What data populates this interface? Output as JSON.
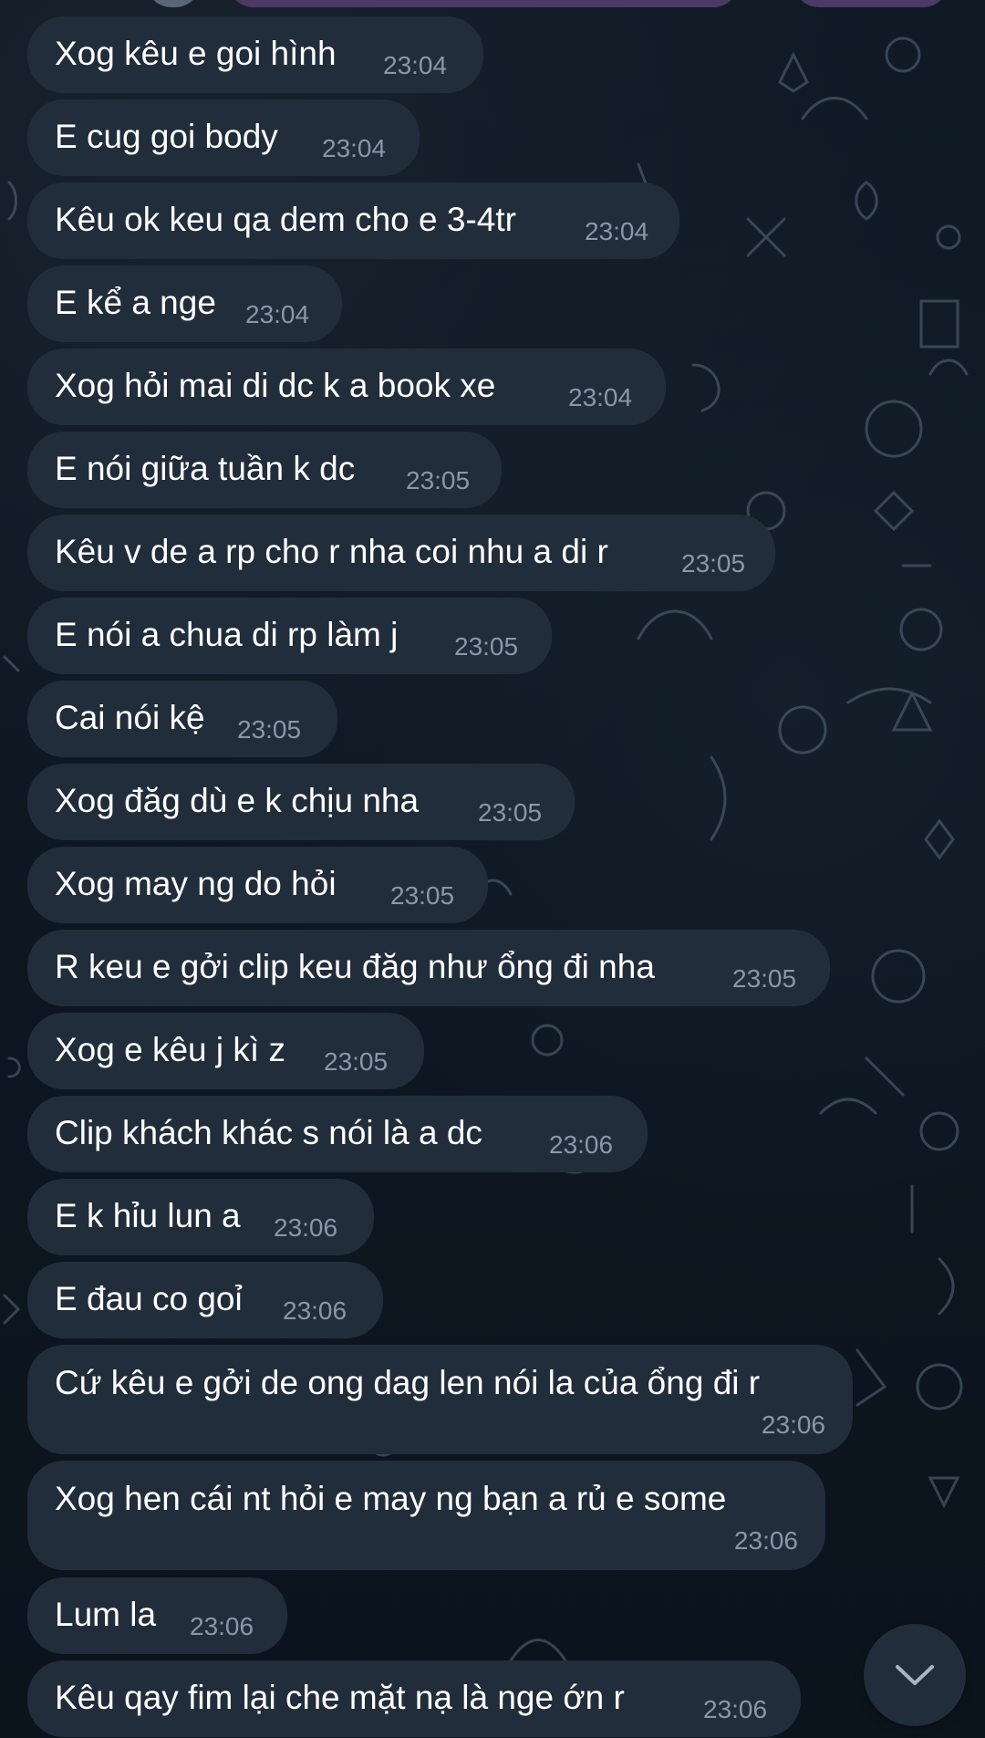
{
  "chat": {
    "messages": [
      {
        "text": "Xog kêu e goi hình",
        "time": "23:04"
      },
      {
        "text": "E cug goi body",
        "time": "23:04"
      },
      {
        "text": "Kêu ok keu qa dem cho e 3-4tr",
        "time": "23:04"
      },
      {
        "text": "E kể a nge",
        "time": "23:04"
      },
      {
        "text": "Xog hỏi mai di dc k a book xe",
        "time": "23:04"
      },
      {
        "text": "E nói giữa tuần k dc",
        "time": "23:05"
      },
      {
        "text": "Kêu v de a rp cho r nha coi nhu a di r",
        "time": "23:05"
      },
      {
        "text": "E nói a chua di rp làm j",
        "time": "23:05"
      },
      {
        "text": "Cai nói kệ",
        "time": "23:05"
      },
      {
        "text": "Xog đăg dù e k chịu nha",
        "time": "23:05"
      },
      {
        "text": "Xog may ng do hỏi",
        "time": "23:05"
      },
      {
        "text": "R keu e gởi clip keu đăg như ổng đi nha",
        "time": "23:05"
      },
      {
        "text": "Xog e kêu j kì z",
        "time": "23:05"
      },
      {
        "text": "Clip khách khác s nói là a dc",
        "time": "23:06"
      },
      {
        "text": "E k hỉu lun a",
        "time": "23:06"
      },
      {
        "text": "E đau co goỉ",
        "time": "23:06"
      },
      {
        "text": "Cứ kêu e gởi de ong dag len nói la của ổng đi r",
        "time": "23:06"
      },
      {
        "text": "Xog hen cái nt hỏi e may ng bạn a rủ e some",
        "time": "23:06"
      },
      {
        "text": "Lum la",
        "time": "23:06"
      },
      {
        "text": "Kêu qay fim lại che mặt nạ là nge ớn r",
        "time": "23:06"
      }
    ]
  },
  "controls": {
    "scroll_down_icon": "chevron-down-icon"
  },
  "colors": {
    "bubble": "#212d3b",
    "background": "#0f1923",
    "text": "#ffffff",
    "time": "#8a97a7",
    "accent": "#4b3a63"
  }
}
